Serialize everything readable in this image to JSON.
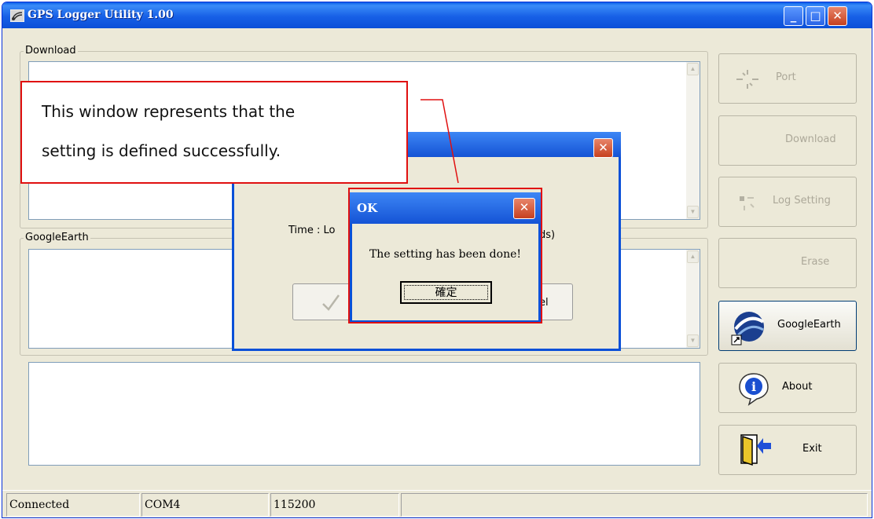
{
  "window": {
    "title": "GPS Logger Utility 1.00",
    "minimize": "_",
    "maximize": "□",
    "close": "✕"
  },
  "groups": {
    "download_label": "Download",
    "googleearth_label": "GoogleEarth"
  },
  "side_buttons": {
    "port": "Port",
    "download": "Download",
    "log_setting": "Log Setting",
    "erase": "Erase",
    "google_earth": "GoogleEarth",
    "about": "About",
    "exit": "Exit"
  },
  "status": {
    "connection": "Connected",
    "port": "COM4",
    "baud": "115200"
  },
  "log_dialog": {
    "close": "✕",
    "time_label_left": "Time : Lo",
    "time_label_right": "ds)",
    "cancel_fragment": "el"
  },
  "ok_box": {
    "title": "OK",
    "close": "✕",
    "message": "The setting has been done!",
    "button": "確定"
  },
  "annotation": {
    "line1": "This window represents that the",
    "line2": "setting is defined successfully."
  }
}
